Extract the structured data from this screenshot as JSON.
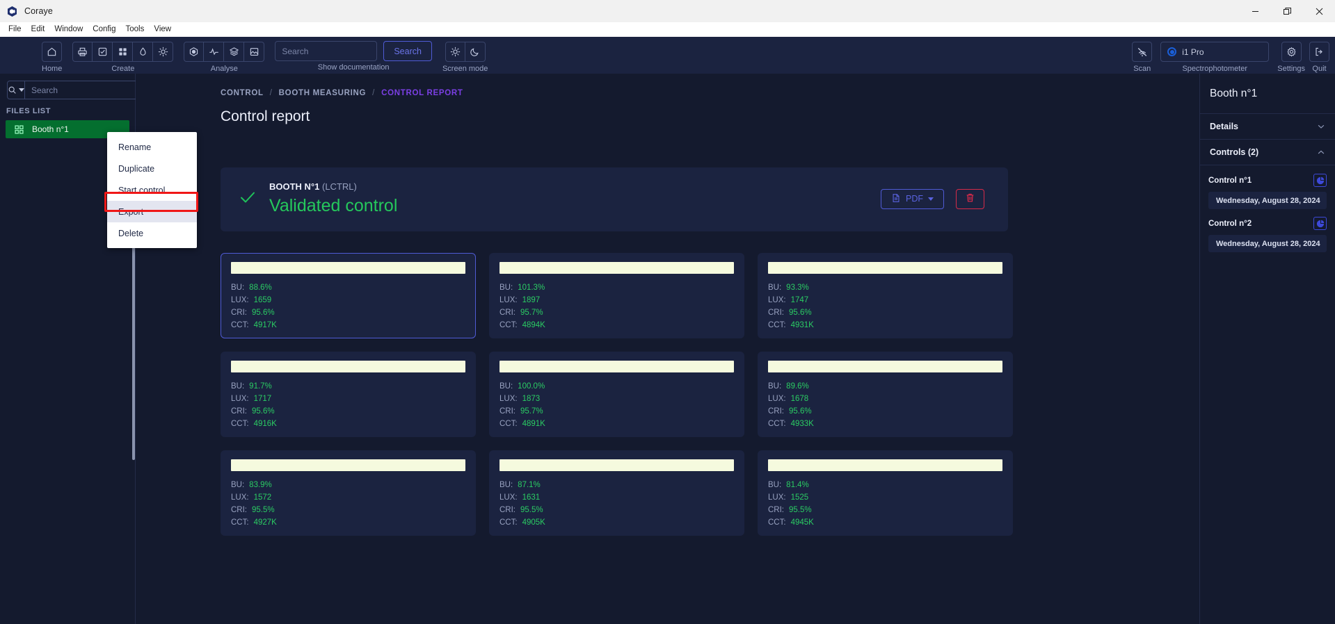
{
  "window": {
    "app_name": "Coraye",
    "controls": {
      "minimize": "minimize-icon",
      "restore": "restore-icon",
      "close": "close-icon"
    }
  },
  "menubar": {
    "items": [
      "File",
      "Edit",
      "Window",
      "Config",
      "Tools",
      "View"
    ]
  },
  "toolbar": {
    "groups": [
      {
        "label": "Home",
        "icons": [
          "home-icon"
        ]
      },
      {
        "label": "Create",
        "icons": [
          "print-icon",
          "checkbox-icon",
          "grid-icon",
          "droplet-icon",
          "sun-icon"
        ]
      },
      {
        "label": "Analyse",
        "icons": [
          "hexagon-icon",
          "pulse-icon",
          "layers-icon",
          "image-icon"
        ]
      }
    ],
    "search": {
      "placeholder": "Search",
      "value": "",
      "button": "Search",
      "label": "Show documentation"
    },
    "screen_mode": {
      "label": "Screen mode",
      "icons": [
        "sun-icon",
        "moon-icon"
      ]
    },
    "scan": {
      "label": "Scan",
      "icon": "signal-off-icon"
    },
    "spectrophotometer": {
      "label": "Spectrophotometer",
      "value": "i1 Pro",
      "icon": "radio-selected-icon"
    },
    "settings": {
      "label": "Settings",
      "icon": "gear-icon"
    },
    "quit": {
      "label": "Quit",
      "icon": "exit-icon"
    }
  },
  "sidebar": {
    "search": {
      "placeholder": "Search",
      "value": "",
      "icon": "search-icon",
      "caret": "chevron-down-icon"
    },
    "files_list_label": "FILES LIST",
    "items": [
      {
        "label": "Booth n°1",
        "icon": "grid-icon",
        "selected": true
      }
    ]
  },
  "context_menu": {
    "items": [
      {
        "label": "Rename",
        "highlighted": false
      },
      {
        "label": "Duplicate",
        "highlighted": false
      },
      {
        "label": "Start control",
        "highlighted": false
      },
      {
        "label": "Export",
        "highlighted": true
      },
      {
        "label": "Delete",
        "highlighted": false
      }
    ],
    "highlight_color": "#f01717"
  },
  "main": {
    "breadcrumb": [
      {
        "label": "CONTROL",
        "active": false
      },
      {
        "label": "BOOTH MEASURING",
        "active": false
      },
      {
        "label": "CONTROL REPORT",
        "active": true
      }
    ],
    "breadcrumb_separator": "/",
    "page_title": "Control report",
    "report": {
      "status_icon": "check-icon",
      "subtitle_bold": "BOOTH N°1",
      "subtitle_dim": "(LCTRL)",
      "title": "Validated control",
      "title_color": "#25c85c",
      "pdf_button": {
        "label": "PDF",
        "icon": "file-icon",
        "caret": "chevron-down-icon"
      },
      "delete_button": {
        "icon": "trash-icon"
      }
    },
    "measurements": [
      {
        "swatch": "#f5fade",
        "selected": true,
        "rows": [
          {
            "key": "BU:",
            "value": "88.6%"
          },
          {
            "key": "LUX:",
            "value": "1659"
          },
          {
            "key": "CRI:",
            "value": "95.6%"
          },
          {
            "key": "CCT:",
            "value": "4917K"
          }
        ]
      },
      {
        "swatch": "#f5fade",
        "selected": false,
        "rows": [
          {
            "key": "BU:",
            "value": "101.3%"
          },
          {
            "key": "LUX:",
            "value": "1897"
          },
          {
            "key": "CRI:",
            "value": "95.7%"
          },
          {
            "key": "CCT:",
            "value": "4894K"
          }
        ]
      },
      {
        "swatch": "#f5fade",
        "selected": false,
        "rows": [
          {
            "key": "BU:",
            "value": "93.3%"
          },
          {
            "key": "LUX:",
            "value": "1747"
          },
          {
            "key": "CRI:",
            "value": "95.6%"
          },
          {
            "key": "CCT:",
            "value": "4931K"
          }
        ]
      },
      {
        "swatch": "#f5fade",
        "selected": false,
        "rows": [
          {
            "key": "BU:",
            "value": "91.7%"
          },
          {
            "key": "LUX:",
            "value": "1717"
          },
          {
            "key": "CRI:",
            "value": "95.6%"
          },
          {
            "key": "CCT:",
            "value": "4916K"
          }
        ]
      },
      {
        "swatch": "#f5fade",
        "selected": false,
        "rows": [
          {
            "key": "BU:",
            "value": "100.0%"
          },
          {
            "key": "LUX:",
            "value": "1873"
          },
          {
            "key": "CRI:",
            "value": "95.7%"
          },
          {
            "key": "CCT:",
            "value": "4891K"
          }
        ]
      },
      {
        "swatch": "#f5fade",
        "selected": false,
        "rows": [
          {
            "key": "BU:",
            "value": "89.6%"
          },
          {
            "key": "LUX:",
            "value": "1678"
          },
          {
            "key": "CRI:",
            "value": "95.6%"
          },
          {
            "key": "CCT:",
            "value": "4933K"
          }
        ]
      },
      {
        "swatch": "#f5fade",
        "selected": false,
        "rows": [
          {
            "key": "BU:",
            "value": "83.9%"
          },
          {
            "key": "LUX:",
            "value": "1572"
          },
          {
            "key": "CRI:",
            "value": "95.5%"
          },
          {
            "key": "CCT:",
            "value": "4927K"
          }
        ]
      },
      {
        "swatch": "#f5fade",
        "selected": false,
        "rows": [
          {
            "key": "BU:",
            "value": "87.1%"
          },
          {
            "key": "LUX:",
            "value": "1631"
          },
          {
            "key": "CRI:",
            "value": "95.5%"
          },
          {
            "key": "CCT:",
            "value": "4905K"
          }
        ]
      },
      {
        "swatch": "#f5fade",
        "selected": false,
        "rows": [
          {
            "key": "BU:",
            "value": "81.4%"
          },
          {
            "key": "LUX:",
            "value": "1525"
          },
          {
            "key": "CRI:",
            "value": "95.5%"
          },
          {
            "key": "CCT:",
            "value": "4945K"
          }
        ]
      }
    ]
  },
  "rightpanel": {
    "title": "Booth n°1",
    "sections": [
      {
        "label": "Details",
        "expanded": false,
        "chevron": "chevron-down-icon"
      },
      {
        "label": "Controls (2)",
        "expanded": true,
        "chevron": "chevron-up-icon"
      }
    ],
    "controls": [
      {
        "label": "Control n°1",
        "icon": "pie-chart-icon",
        "date": "Wednesday, August 28, 2024"
      },
      {
        "label": "Control n°2",
        "icon": "pie-chart-icon",
        "date": "Wednesday, August 28, 2024"
      }
    ]
  },
  "colors": {
    "accent": "#4f5bd5",
    "success": "#25c85c",
    "danger": "#e02a4a",
    "breadcrumb_active": "#7b3fe4"
  }
}
